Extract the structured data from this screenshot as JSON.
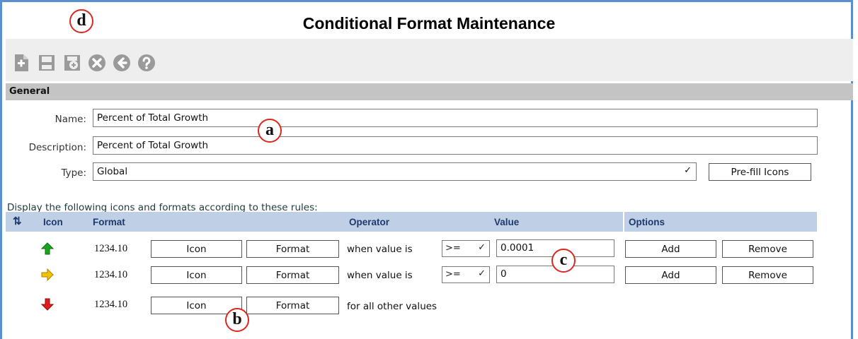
{
  "page_title": "Conditional Format Maintenance",
  "toolbar": {
    "buttons": [
      {
        "icon": "new-icon"
      },
      {
        "icon": "save-icon"
      },
      {
        "icon": "save-as-icon"
      },
      {
        "icon": "cancel-icon"
      },
      {
        "icon": "back-icon"
      },
      {
        "icon": "help-icon"
      }
    ]
  },
  "section": {
    "general": "General"
  },
  "form": {
    "name_label": "Name:",
    "name_value": "Percent of Total Growth",
    "description_label": "Description:",
    "description_value": "Percent of Total Growth",
    "type_label": "Type:",
    "type_value": "Global",
    "prefill_button": "Pre-fill Icons"
  },
  "rules": {
    "caption": "Display the following icons and formats according to these rules:",
    "headers": {
      "sort": "⇅",
      "icon": "Icon",
      "format": "Format",
      "operator": "Operator",
      "value": "Value",
      "options": "Options"
    },
    "rows": [
      {
        "arrow": "up-green",
        "format": "1234.10",
        "icon_button": "Icon",
        "format_button": "Format",
        "when_text": "when value is",
        "operator": ">=",
        "value": "0.0001",
        "add": "Add",
        "remove": "Remove"
      },
      {
        "arrow": "right-yellow",
        "format": "1234.10",
        "icon_button": "Icon",
        "format_button": "Format",
        "when_text": "when value is",
        "operator": ">=",
        "value": "0",
        "add": "Add",
        "remove": "Remove"
      },
      {
        "arrow": "down-red",
        "format": "1234.10",
        "icon_button": "Icon",
        "format_button": "Format",
        "other_text": "for all other values"
      }
    ]
  },
  "callouts": {
    "a": "a",
    "b": "b",
    "c": "c",
    "d": "d"
  },
  "colors": {
    "toolbar_icon": "#9a9a9a",
    "header_bg": "#bfd0e6",
    "callout_border": "#d9281f",
    "arrow_green": "#19a51d",
    "arrow_yellow": "#f2c200",
    "arrow_red": "#e01b1b"
  }
}
